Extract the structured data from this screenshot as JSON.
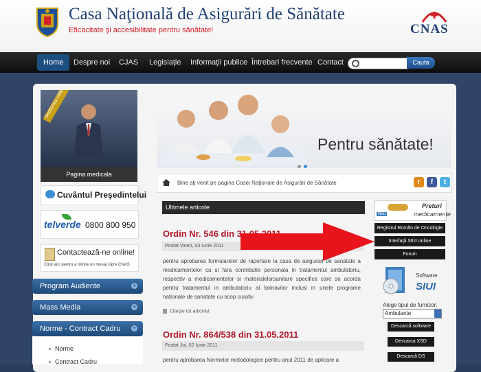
{
  "header": {
    "title": "Casa Naţională de Asigurări de Sănătate",
    "tagline": "Eficacitate şi accesibilitate pentru sănătate!",
    "logo_text": "CNAS"
  },
  "nav": {
    "items": [
      "Home",
      "Despre noi",
      "CJAS",
      "Legislaţie",
      "Informaţii publice",
      "Întrebari frecvente",
      "Contact"
    ],
    "search_button": "Cauta",
    "search_placeholder": ""
  },
  "sidebar": {
    "video_ribbon": "Sectiunea Video",
    "video_caption": "Pagina medicala",
    "presedinte_label": "Cuvântul Preşedintelui",
    "telverde_brand": "telverde",
    "telverde_number": "0800 800 950",
    "contact_label": "Contactează-ne online!",
    "contact_sub": "Click aici pentru a trimite un mesaj către CNAS",
    "menu": [
      "Program Audiente",
      "Mass Media",
      "Norme - Contract Cadru"
    ],
    "submenu": [
      "Norme",
      "Contract Cadru"
    ]
  },
  "banner": {
    "text": "Pentru sănătate!"
  },
  "breadcrumb": {
    "text": "Bine aţi venit pe pagina Casei Naţionale de Asigurări de Sănătate"
  },
  "articles": {
    "header": "Ultimele articole",
    "items": [
      {
        "title": "Ordin Nr. 546 din 31.05.2011",
        "meta": "Postat Vineri, 03 Iunie 2011",
        "body": "pentru aprobarea formularelor de raportare la casa de asigurari de sanatate a medicamentelor cu si fara contributie personala in tratamentul ambulatoriu, respectiv a medicamentelor si materialelorsanitare specifice care se acorda pentru tratamentul in ambulatoriu al bolnavilor inclusi in unele programe nationale de sanatate cu scop curativ",
        "readmore": "Citeşte tot articolul"
      },
      {
        "title": "Ordin Nr. 864/538 din 31.05.2011",
        "meta": "Postat Joi, 02 Iunie 2011",
        "body": "pentru aprobarea Normelor metodologice pentru anul 2011 de aplicare a"
      }
    ]
  },
  "right_panel": {
    "preturi_badge": "Nou",
    "preturi_title": "Preturi",
    "preturi_sub": "medicamente",
    "links": [
      "Registrul Român de Oncologie",
      "Interfaţă SIUI online",
      "Forum"
    ],
    "siui_line1": "Software",
    "siui_line2": "SIUI",
    "furnizor_label": "Alege tipul de furnizor:",
    "furnizor_value": "Ambulante",
    "downloads": [
      "Descarcă software",
      "Descarca XSD",
      "Descarcă DS"
    ]
  },
  "colors": {
    "accent_blue": "#1f3f73",
    "tagline_red": "#d0202a",
    "article_title_red": "#b0182a",
    "arrow_red": "#e8141c"
  }
}
